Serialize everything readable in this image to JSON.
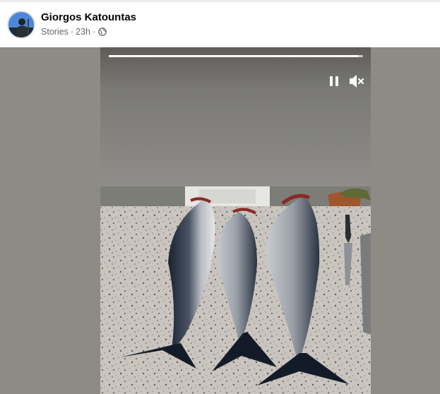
{
  "post": {
    "author_name": "Giorgos Katountas",
    "meta_source": "Stories",
    "meta_separator": "·",
    "meta_time": "23h",
    "meta_separator_2": "·",
    "privacy_icon": "globe-icon",
    "avatar_icon": "profile-avatar"
  },
  "story": {
    "progress": 0.98,
    "controls": {
      "pause_icon": "pause-icon",
      "mute_icon": "speaker-muted-icon"
    },
    "photo_description_icon": "story-photo"
  },
  "colors": {
    "author_text": "#050505",
    "meta_text": "#65676b",
    "viewer_bg": "#8d8b84"
  }
}
